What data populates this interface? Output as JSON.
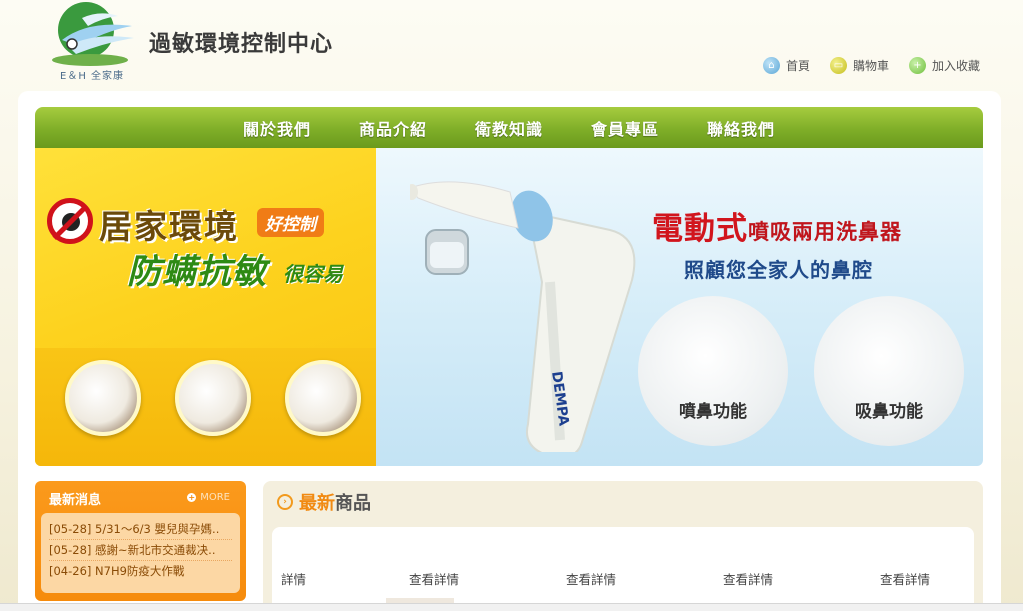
{
  "header": {
    "logo_text": "E＆H 全家康",
    "site_title": "過敏環境控制中心",
    "top_links": [
      "首頁",
      "購物車",
      "加入收藏"
    ]
  },
  "nav": {
    "items": [
      "關於我們",
      "商品介紹",
      "衛教知識",
      "會員專區",
      "聯絡我們"
    ]
  },
  "banner": {
    "left_line1": "居家環境",
    "left_badge": "好控制",
    "left_line2": "防螨抗敏",
    "left_line2_suffix": "很容易",
    "right_title_main": "電動式",
    "right_title_sub": "噴吸兩用洗鼻器",
    "right_subtitle": "照顧您全家人的鼻腔",
    "device_brand": "DEMPA",
    "feature_1": "噴鼻功能",
    "feature_2": "吸鼻功能"
  },
  "news": {
    "title": "最新消息",
    "more": "MORE",
    "items": [
      "[05-28] 5/31～6/3 嬰兒與孕媽..",
      "[05-28] 感謝~新北市交通裁决..",
      "[04-26] N7H9防疫大作戰"
    ]
  },
  "products": {
    "title_highlight": "最新",
    "title_rest": "商品",
    "detail_links": [
      "詳情",
      "查看詳情",
      "查看詳情",
      "查看詳情",
      "查看詳情"
    ]
  },
  "colors": {
    "nav_green": "#7fae28",
    "news_orange": "#f68b0c",
    "title_red": "#d1151d",
    "accent_orange": "#f18a12"
  }
}
